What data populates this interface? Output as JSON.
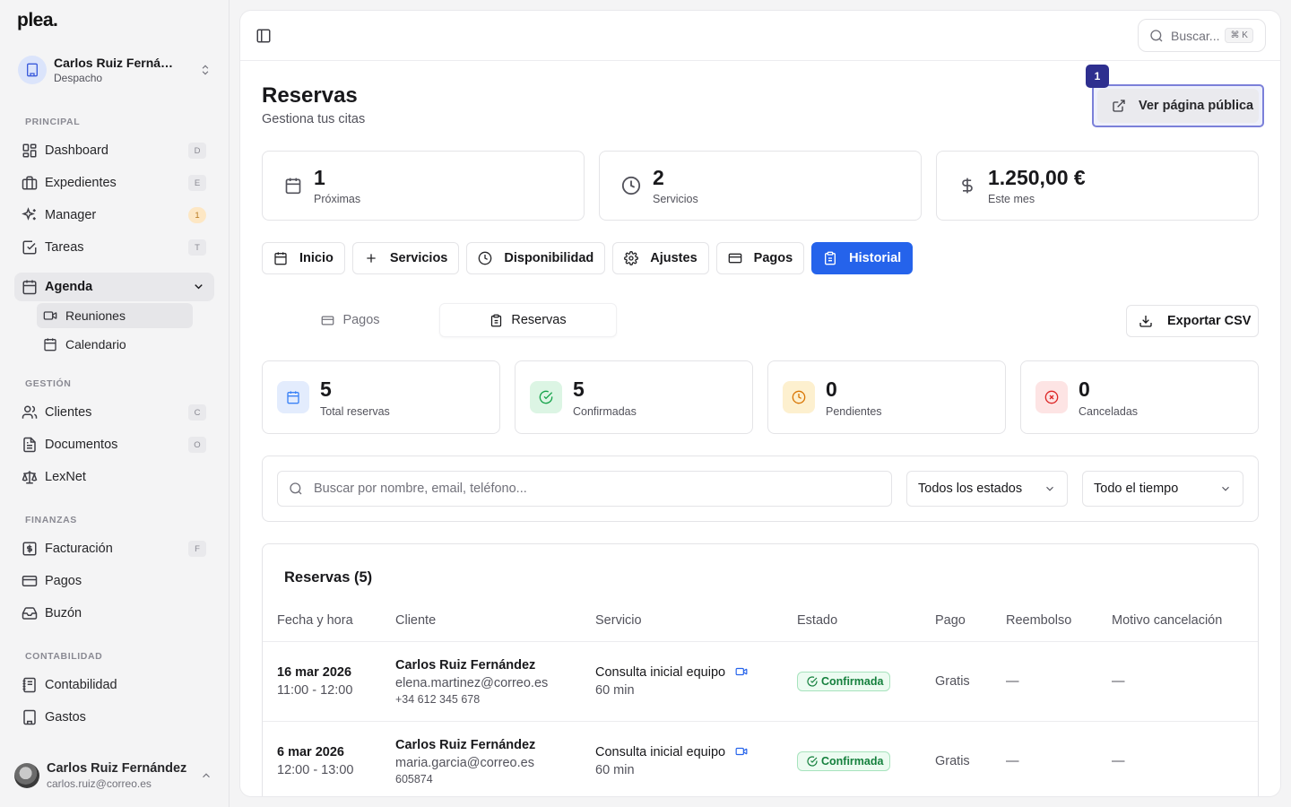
{
  "app": {
    "logo": "plea."
  },
  "org": {
    "name": "Carlos Ruiz Fernán…",
    "type": "Despacho"
  },
  "sidebar": {
    "sections": {
      "principal": "PRINCIPAL",
      "gestion": "GESTIÓN",
      "finanzas": "FINANZAS",
      "contabilidad": "CONTABILIDAD"
    },
    "items": {
      "dashboard": {
        "label": "Dashboard",
        "kbd": "D"
      },
      "expedientes": {
        "label": "Expedientes",
        "kbd": "E"
      },
      "manager": {
        "label": "Manager",
        "badge": "1"
      },
      "tareas": {
        "label": "Tareas",
        "kbd": "T"
      },
      "agenda": {
        "label": "Agenda"
      },
      "reuniones": {
        "label": "Reuniones"
      },
      "calendario": {
        "label": "Calendario"
      },
      "clientes": {
        "label": "Clientes",
        "kbd": "C"
      },
      "documentos": {
        "label": "Documentos",
        "kbd": "O"
      },
      "lexnet": {
        "label": "LexNet"
      },
      "facturacion": {
        "label": "Facturación",
        "kbd": "F"
      },
      "pagos": {
        "label": "Pagos"
      },
      "buzon": {
        "label": "Buzón"
      },
      "contabilidad": {
        "label": "Contabilidad"
      },
      "gastos": {
        "label": "Gastos"
      }
    }
  },
  "user": {
    "name": "Carlos Ruiz Fernández",
    "email": "carlos.ruiz@correo.es"
  },
  "topbar": {
    "search_placeholder": "Buscar...",
    "search_kbd": "⌘ K"
  },
  "page": {
    "title": "Reservas",
    "subtitle": "Gestiona tus citas",
    "public_button": "Ver página pública",
    "public_badge": "1"
  },
  "stats": [
    {
      "value": "1",
      "label": "Próximas",
      "icon": "calendar-icon"
    },
    {
      "value": "2",
      "label": "Servicios",
      "icon": "clock-icon"
    },
    {
      "value": "1.250,00 €",
      "label": "Este mes",
      "icon": "dollar-icon"
    }
  ],
  "tabs": [
    {
      "label": "Inicio"
    },
    {
      "label": "Servicios"
    },
    {
      "label": "Disponibilidad"
    },
    {
      "label": "Ajustes"
    },
    {
      "label": "Pagos"
    },
    {
      "label": "Historial",
      "active": true
    }
  ],
  "segments": {
    "pagos": "Pagos",
    "reservas": "Reservas"
  },
  "export_label": "Exportar CSV",
  "kpis": [
    {
      "value": "5",
      "label": "Total reservas",
      "color": "#3b82f6"
    },
    {
      "value": "5",
      "label": "Confirmadas",
      "color": "#16a34a"
    },
    {
      "value": "0",
      "label": "Pendientes",
      "color": "#d97706"
    },
    {
      "value": "0",
      "label": "Canceladas",
      "color": "#dc2626"
    }
  ],
  "filters": {
    "search_placeholder": "Buscar por nombre, email, teléfono...",
    "status": "Todos los estados",
    "period": "Todo el tiempo"
  },
  "table": {
    "title": "Reservas (5)",
    "headers": [
      "Fecha y hora",
      "Cliente",
      "Servicio",
      "Estado",
      "Pago",
      "Reembolso",
      "Motivo cancelación"
    ],
    "rows": [
      {
        "date": "16 mar 2026",
        "time": "11:00 - 12:00",
        "client": "Carlos Ruiz Fernández",
        "email": "elena.martinez@correo.es",
        "phone": "+34 612 345 678",
        "service": "Consulta inicial equipo",
        "duration": "60 min",
        "status": "Confirmada",
        "payment": "Gratis",
        "refund": "—",
        "reason": "—"
      },
      {
        "date": "6 mar 2026",
        "time": "12:00 - 13:00",
        "client": "Carlos Ruiz Fernández",
        "email": "maria.garcia@correo.es",
        "phone": "605874",
        "service": "Consulta inicial equipo",
        "duration": "60 min",
        "status": "Confirmada",
        "payment": "Gratis",
        "refund": "—",
        "reason": "—"
      }
    ]
  }
}
